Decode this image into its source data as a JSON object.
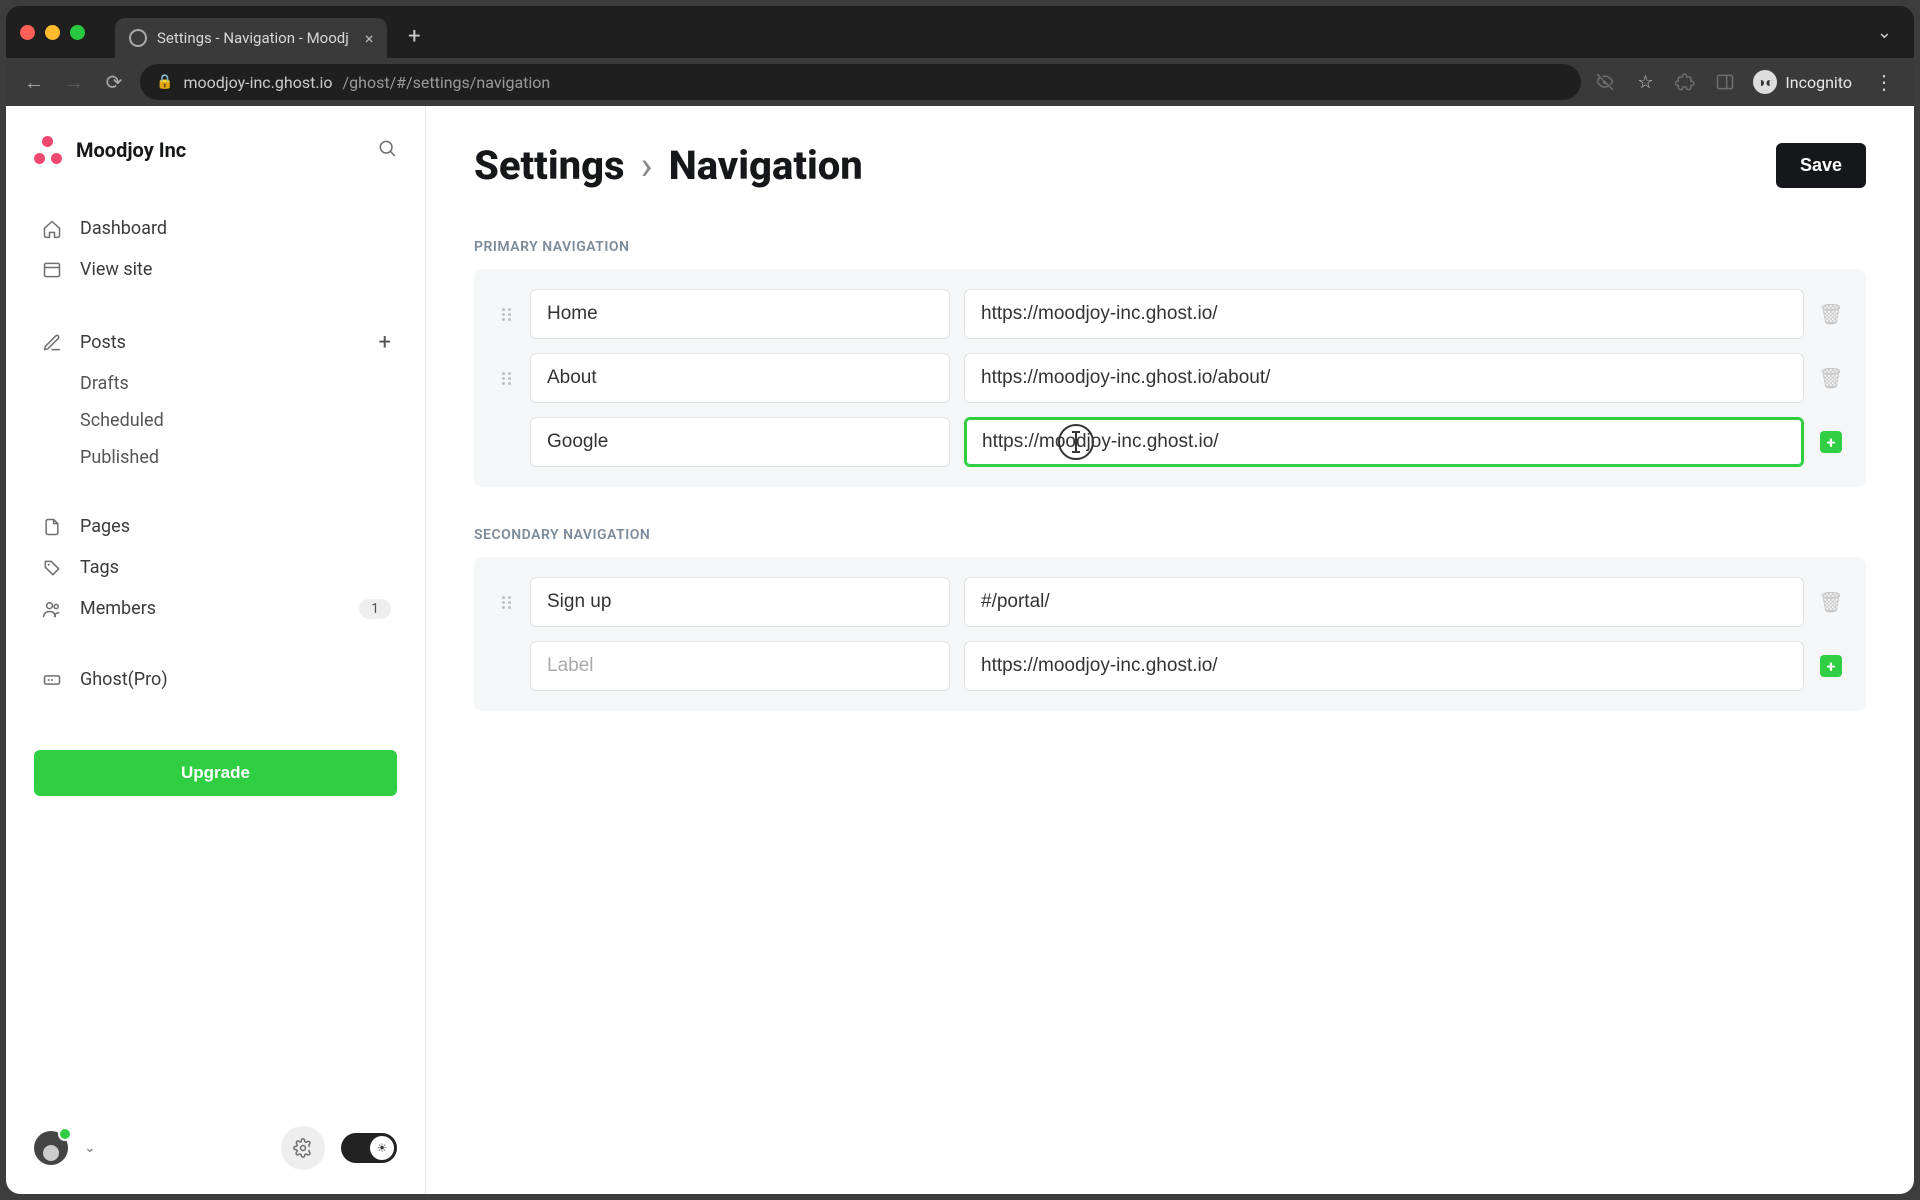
{
  "browser": {
    "tab_title": "Settings - Navigation - Moodj",
    "url_host": "moodjoy-inc.ghost.io",
    "url_path": "/ghost/#/settings/navigation",
    "incognito_label": "Incognito"
  },
  "sidebar": {
    "brand": "Moodjoy Inc",
    "items": {
      "dashboard": "Dashboard",
      "view_site": "View site",
      "posts": "Posts",
      "drafts": "Drafts",
      "scheduled": "Scheduled",
      "published": "Published",
      "pages": "Pages",
      "tags": "Tags",
      "members": "Members",
      "members_count": "1",
      "ghost_pro": "Ghost(Pro)"
    },
    "upgrade_label": "Upgrade"
  },
  "page": {
    "breadcrumb_parent": "Settings",
    "breadcrumb_current": "Navigation",
    "save_label": "Save"
  },
  "primary": {
    "section_label": "Primary navigation",
    "rows": [
      {
        "label": "Home",
        "url": "https://moodjoy-inc.ghost.io/"
      },
      {
        "label": "About",
        "url": "https://moodjoy-inc.ghost.io/about/"
      }
    ],
    "new_row": {
      "label": "Google",
      "url": "https://moodjoy-inc.ghost.io/"
    }
  },
  "secondary": {
    "section_label": "Secondary navigation",
    "rows": [
      {
        "label": "Sign up",
        "url": "#/portal/"
      }
    ],
    "new_row": {
      "label_placeholder": "Label",
      "url": "https://moodjoy-inc.ghost.io/"
    }
  }
}
